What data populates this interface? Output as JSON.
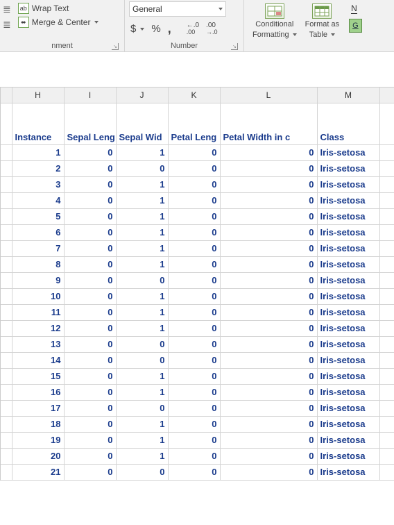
{
  "ribbon": {
    "wrap_text": "Wrap Text",
    "merge_center": "Merge & Center",
    "alignment_label": "nment",
    "number_format": "General",
    "currency": "$",
    "percent": "%",
    "comma": ",",
    "inc_dec_1": ".0",
    "inc_dec_2": ".00",
    "number_label": "Number",
    "conditional": "Conditional",
    "formatting": "Formatting",
    "format_as": "Format as",
    "table": "Table",
    "notes_n": "N",
    "go": "G"
  },
  "columns": [
    "H",
    "I",
    "J",
    "K",
    "L",
    "M"
  ],
  "headers": {
    "H": "Instance",
    "I": "Sepal Leng",
    "J": "Sepal Wid",
    "K": "Petal Leng",
    "L": "Petal Width in c",
    "M": "Class"
  },
  "rows": [
    {
      "H": "1",
      "I": "0",
      "J": "1",
      "K": "0",
      "L": "0",
      "M": "Iris-setosa"
    },
    {
      "H": "2",
      "I": "0",
      "J": "0",
      "K": "0",
      "L": "0",
      "M": "Iris-setosa"
    },
    {
      "H": "3",
      "I": "0",
      "J": "1",
      "K": "0",
      "L": "0",
      "M": "Iris-setosa"
    },
    {
      "H": "4",
      "I": "0",
      "J": "1",
      "K": "0",
      "L": "0",
      "M": "Iris-setosa"
    },
    {
      "H": "5",
      "I": "0",
      "J": "1",
      "K": "0",
      "L": "0",
      "M": "Iris-setosa"
    },
    {
      "H": "6",
      "I": "0",
      "J": "1",
      "K": "0",
      "L": "0",
      "M": "Iris-setosa"
    },
    {
      "H": "7",
      "I": "0",
      "J": "1",
      "K": "0",
      "L": "0",
      "M": "Iris-setosa"
    },
    {
      "H": "8",
      "I": "0",
      "J": "1",
      "K": "0",
      "L": "0",
      "M": "Iris-setosa"
    },
    {
      "H": "9",
      "I": "0",
      "J": "0",
      "K": "0",
      "L": "0",
      "M": "Iris-setosa"
    },
    {
      "H": "10",
      "I": "0",
      "J": "1",
      "K": "0",
      "L": "0",
      "M": "Iris-setosa"
    },
    {
      "H": "11",
      "I": "0",
      "J": "1",
      "K": "0",
      "L": "0",
      "M": "Iris-setosa"
    },
    {
      "H": "12",
      "I": "0",
      "J": "1",
      "K": "0",
      "L": "0",
      "M": "Iris-setosa"
    },
    {
      "H": "13",
      "I": "0",
      "J": "0",
      "K": "0",
      "L": "0",
      "M": "Iris-setosa"
    },
    {
      "H": "14",
      "I": "0",
      "J": "0",
      "K": "0",
      "L": "0",
      "M": "Iris-setosa"
    },
    {
      "H": "15",
      "I": "0",
      "J": "1",
      "K": "0",
      "L": "0",
      "M": "Iris-setosa"
    },
    {
      "H": "16",
      "I": "0",
      "J": "1",
      "K": "0",
      "L": "0",
      "M": "Iris-setosa"
    },
    {
      "H": "17",
      "I": "0",
      "J": "0",
      "K": "0",
      "L": "0",
      "M": "Iris-setosa"
    },
    {
      "H": "18",
      "I": "0",
      "J": "1",
      "K": "0",
      "L": "0",
      "M": "Iris-setosa"
    },
    {
      "H": "19",
      "I": "0",
      "J": "1",
      "K": "0",
      "L": "0",
      "M": "Iris-setosa"
    },
    {
      "H": "20",
      "I": "0",
      "J": "1",
      "K": "0",
      "L": "0",
      "M": "Iris-setosa"
    },
    {
      "H": "21",
      "I": "0",
      "J": "0",
      "K": "0",
      "L": "0",
      "M": "Iris-setosa"
    }
  ]
}
